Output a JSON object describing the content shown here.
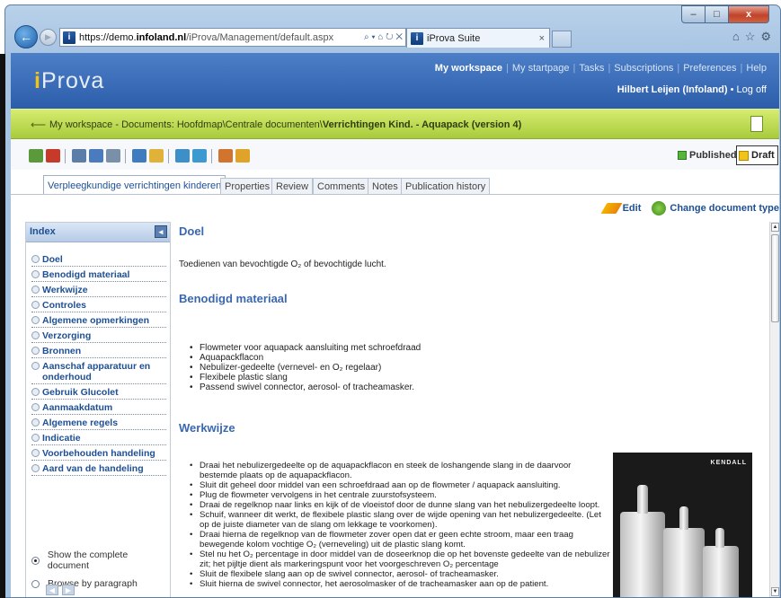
{
  "browser": {
    "url_host": "https://demo.",
    "url_bold": "infoland.nl",
    "url_rest": "/iProva/Management/default.aspx",
    "addr_icons": "⌕ ▾ ⌂ ↻ ✕",
    "tab_title": "iProva Suite",
    "tab_close": "×",
    "fav_letter": "i",
    "min": "–",
    "max": "□",
    "close": "x",
    "ie_icons": [
      "⌂",
      "☆",
      "⚙"
    ]
  },
  "header": {
    "logo_i": "i",
    "logo_rest": "Prova",
    "nav": [
      "My workspace",
      "My startpage",
      "Tasks",
      "Subscriptions",
      "Preferences",
      "Help"
    ],
    "sep": "|",
    "user": "Hilbert Leijen (Infoland)",
    "dot": "•",
    "logoff": "Log off"
  },
  "breadcrumb": {
    "arrow": "⟵",
    "path": "My workspace - Documents: Hoofdmap\\Centrale documenten\\",
    "bold": "Verrichtingen Kind. - Aquapack (version 4)"
  },
  "status": {
    "published": "Published",
    "draft": "Draft"
  },
  "tabs": [
    "Verpleegkundige verrichtingen kinderen",
    "Properties",
    "Review",
    "Comments",
    "Notes",
    "Publication history"
  ],
  "actions": {
    "edit": "Edit",
    "change_type": "Change document type"
  },
  "sidebar": {
    "title": "Index",
    "collapse": "◂",
    "items": [
      "Doel",
      "Benodigd materiaal",
      "Werkwijze",
      "Controles",
      "Algemene opmerkingen",
      "Verzorging",
      "Bronnen",
      "Aanschaf apparatuur en onderhoud",
      "Gebruik Glucolet",
      "Aanmaakdatum",
      "Algemene regels",
      "Indicatie",
      "Voorbehouden handeling",
      "Aard van de handeling"
    ],
    "opt_complete": "Show the complete document",
    "opt_paragraph": "Browse by paragraph",
    "prev": "◀",
    "next": "▶"
  },
  "document": {
    "doel_title": "Doel",
    "doel_text": "Toedienen van bevochtigde O₂ of bevochtigde lucht.",
    "ben_title": "Benodigd materiaal",
    "ben_items": [
      "Flowmeter voor aquapack aansluiting met schroefdraad",
      "Aquapackflacon",
      "Nebulizer-gedeelte (vernevel- en O₂ regelaar)",
      "Flexibele plastic slang",
      "Passend swivel connector, aerosol- of tracheamasker."
    ],
    "wer_title": "Werkwijze",
    "wer_items": [
      "Draai het nebulizergedeelte op de aquapackflacon en steek de loshangende slang in de daarvoor bestemde plaats op de aquapackflacon.",
      "Sluit dit geheel door middel van een schroefdraad aan op de flowmeter / aquapack aansluiting.",
      "Plug de flowmeter vervolgens in het centrale zuurstofsysteem.",
      "Draai de regelknop naar links en kijk of de vloeistof door de dunne slang van het nebulizergedeelte loopt.",
      "Schuif, wanneer dit werkt, de flexibele plastic slang over de wijde opening van het nebulizergedeelte. (Let op de juiste diameter van de slang om lekkage te voorkomen).",
      "Draai hierna de regelknop van de flowmeter zover open dat er geen echte stroom, maar een traag bewegende kolom vochtige O₂ (verneveling) uit de plastic slang komt.",
      "Stel nu het O₂ percentage in door middel van de doseerknop die op het bovenste gedeelte van de nebulizer zit; het pijltje dient als markeringspunt voor het voorgeschreven O₂ percentage",
      "Sluit de flexibele slang aan op de swivel connector, aerosol- of tracheamasker.",
      "Sluit hierna de swivel connector, het aerosolmasker of de tracheamasker aan op de patient."
    ],
    "photo_brand": "KENDALL"
  },
  "scroll": {
    "up": "▲",
    "down": "▼"
  }
}
